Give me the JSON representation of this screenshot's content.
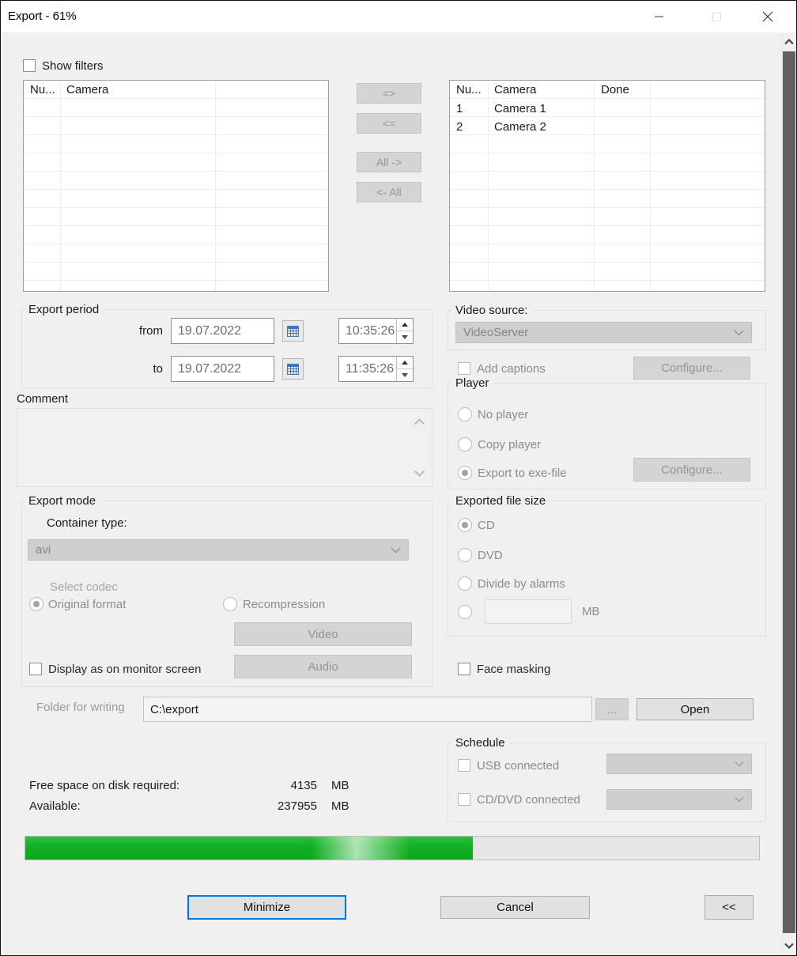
{
  "window": {
    "title": "Export - 61%"
  },
  "filters": {
    "label": "Show filters"
  },
  "source_table": {
    "columns": [
      "Nu...",
      "Camera"
    ]
  },
  "transfer": {
    "to_right": "=>",
    "to_left": "<=",
    "all_right": "All ->",
    "all_left": "<- All"
  },
  "dest_table": {
    "columns": [
      "Nu...",
      "Camera",
      "Done"
    ],
    "rows": [
      [
        "1",
        "Camera 1",
        ""
      ],
      [
        "2",
        "Camera 2",
        ""
      ]
    ]
  },
  "export_period": {
    "title": "Export period",
    "from_label": "from",
    "to_label": "to",
    "from_date": "19.07.2022",
    "from_time": "10:35:26",
    "to_date": "19.07.2022",
    "to_time": "11:35:26"
  },
  "video_source": {
    "title": "Video source:",
    "selected": "VideoServer"
  },
  "captions": {
    "label": "Add captions",
    "configure_label": "Configure..."
  },
  "player": {
    "title": "Player",
    "no_player": "No player",
    "copy_player": "Copy player",
    "export_exe": "Export to exe-file",
    "selected": "Export to exe-file",
    "configure_label": "Configure..."
  },
  "comment": {
    "title": "Comment",
    "value": ""
  },
  "export_mode": {
    "title": "Export mode",
    "container_type_label": "Container type:",
    "container_type": "avi",
    "select_codec_label": "Select codec",
    "original_format": "Original format",
    "recompression": "Recompression",
    "selected_codec": "Original format",
    "video_button": "Video",
    "audio_button": "Audio",
    "display_checkbox": "Display as on monitor screen"
  },
  "file_size": {
    "title": "Exported file size",
    "cd": "CD",
    "dvd": "DVD",
    "divide": "Divide by alarms",
    "custom_value": "",
    "unit": "MB",
    "selected": "CD"
  },
  "face_masking": {
    "label": "Face masking"
  },
  "folder": {
    "label": "Folder for writing",
    "value": "C:\\export",
    "browse_label": "...",
    "open_label": "Open"
  },
  "disk": {
    "required_label": "Free space on disk required:",
    "required_value": "4135",
    "required_unit": "MB",
    "available_label": "Available:",
    "available_value": "237955",
    "available_unit": "MB"
  },
  "schedule": {
    "title": "Schedule",
    "usb": "USB connected",
    "cddvd": "CD/DVD connected"
  },
  "progress": {
    "percent": 61
  },
  "actions": {
    "minimize": "Minimize",
    "cancel": "Cancel",
    "collapse": "<<"
  }
}
